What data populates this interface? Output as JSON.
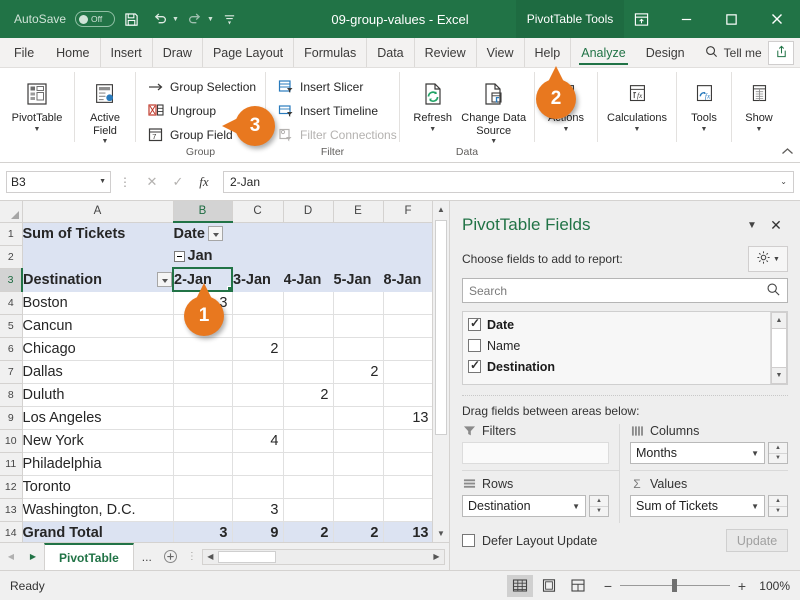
{
  "titlebar": {
    "autosave_label": "AutoSave",
    "autosave_state": "Off",
    "document_title": "09-group-values  -  Excel",
    "contextual_tab": "PivotTable Tools",
    "save_icon": "save-icon",
    "undo_icon": "undo-icon",
    "redo_icon": "redo-icon",
    "customize_icon": "customize-quick-access-icon",
    "ribbon_display_icon": "ribbon-display-options-icon",
    "minimize_icon": "minimize-icon",
    "maximize_icon": "maximize-icon",
    "close_icon": "close-icon"
  },
  "ribbon_tabs": [
    {
      "label": "File",
      "active": false
    },
    {
      "label": "Home",
      "active": false
    },
    {
      "label": "Insert",
      "active": false
    },
    {
      "label": "Draw",
      "active": false
    },
    {
      "label": "Page Layout",
      "active": false
    },
    {
      "label": "Formulas",
      "active": false
    },
    {
      "label": "Data",
      "active": false
    },
    {
      "label": "Review",
      "active": false
    },
    {
      "label": "View",
      "active": false
    },
    {
      "label": "Help",
      "active": false
    },
    {
      "label": "Analyze",
      "active": true
    },
    {
      "label": "Design",
      "active": false
    }
  ],
  "tellme": {
    "label": "Tell me",
    "icon": "search-icon"
  },
  "share": {
    "icon": "share-icon"
  },
  "ribbon": {
    "groups": [
      {
        "label": "",
        "buttons": [
          {
            "label": "PivotTable",
            "icon": "pivottable-icon",
            "caret": true
          }
        ]
      },
      {
        "label": "",
        "buttons": [
          {
            "label": "Active Field",
            "icon": "active-field-icon",
            "caret": true
          }
        ]
      },
      {
        "label": "Group",
        "small": [
          {
            "label": "Group Selection",
            "icon": "group-selection-icon",
            "disabled": false
          },
          {
            "label": "Ungroup",
            "icon": "ungroup-icon",
            "disabled": false
          },
          {
            "label": "Group Field",
            "icon": "group-field-icon",
            "disabled": false
          }
        ]
      },
      {
        "label": "Filter",
        "small": [
          {
            "label": "Insert Slicer",
            "icon": "insert-slicer-icon",
            "disabled": false
          },
          {
            "label": "Insert Timeline",
            "icon": "insert-timeline-icon",
            "disabled": false
          },
          {
            "label": "Filter Connections",
            "icon": "filter-connections-icon",
            "disabled": true
          }
        ]
      },
      {
        "label": "Data",
        "buttons": [
          {
            "label": "Refresh",
            "icon": "refresh-icon",
            "caret": true
          },
          {
            "label": "Change Data Source",
            "icon": "change-data-source-icon",
            "caret": true
          }
        ]
      },
      {
        "label": "",
        "buttons": [
          {
            "label": "Actions",
            "icon": "actions-icon",
            "caret": true
          }
        ]
      },
      {
        "label": "",
        "buttons": [
          {
            "label": "Calculations",
            "icon": "calculations-icon",
            "caret": true
          }
        ]
      },
      {
        "label": "",
        "buttons": [
          {
            "label": "Tools",
            "icon": "tools-icon",
            "caret": true
          }
        ]
      },
      {
        "label": "",
        "buttons": [
          {
            "label": "Show",
            "icon": "show-icon",
            "caret": true
          }
        ]
      }
    ],
    "collapse_icon": "collapse-ribbon-icon"
  },
  "formulabar": {
    "namebox_value": "B3",
    "cancel_icon": "cancel-icon",
    "enter_icon": "enter-icon",
    "function_icon": "insert-function-icon",
    "formula_value": "2-Jan",
    "expand_icon": "expand-formula-bar-icon"
  },
  "grid": {
    "columns": [
      "A",
      "B",
      "C",
      "D",
      "E",
      "F"
    ],
    "selected_column": "B",
    "selected_row": "3",
    "active_cell": "B3",
    "rows": [
      {
        "num": "1",
        "cells": [
          "Sum of Tickets",
          "Date",
          "",
          "",
          "",
          ""
        ]
      },
      {
        "num": "2",
        "cells": [
          "",
          "Jan",
          "",
          "",
          "",
          ""
        ]
      },
      {
        "num": "3",
        "cells": [
          "Destination",
          "2-Jan",
          "3-Jan",
          "4-Jan",
          "5-Jan",
          "8-Jan"
        ]
      },
      {
        "num": "4",
        "cells": [
          "Boston",
          "3",
          "",
          "",
          "",
          ""
        ]
      },
      {
        "num": "5",
        "cells": [
          "Cancun",
          "",
          "",
          "",
          "",
          ""
        ]
      },
      {
        "num": "6",
        "cells": [
          "Chicago",
          "",
          "2",
          "",
          "",
          ""
        ]
      },
      {
        "num": "7",
        "cells": [
          "Dallas",
          "",
          "",
          "",
          "2",
          ""
        ]
      },
      {
        "num": "8",
        "cells": [
          "Duluth",
          "",
          "",
          "2",
          "",
          ""
        ]
      },
      {
        "num": "9",
        "cells": [
          "Los Angeles",
          "",
          "",
          "",
          "",
          "13"
        ]
      },
      {
        "num": "10",
        "cells": [
          "New York",
          "",
          "4",
          "",
          "",
          ""
        ]
      },
      {
        "num": "11",
        "cells": [
          "Philadelphia",
          "",
          "",
          "",
          "",
          ""
        ]
      },
      {
        "num": "12",
        "cells": [
          "Toronto",
          "",
          "",
          "",
          "",
          ""
        ]
      },
      {
        "num": "13",
        "cells": [
          "Washington, D.C.",
          "",
          "3",
          "",
          "",
          ""
        ]
      },
      {
        "num": "14",
        "cells": [
          "Grand Total",
          "3",
          "9",
          "2",
          "2",
          "13"
        ]
      }
    ],
    "group_label": "Jan",
    "collapse_icon": "collapse-group-icon",
    "field_filter_icon": "filter-dropdown-icon"
  },
  "sheet_tabs": {
    "prev_icon": "previous-sheet-icon",
    "next_icon": "next-sheet-icon",
    "tabs": [
      "PivotTable"
    ],
    "more": "...",
    "add_icon": "add-sheet-icon"
  },
  "pivot_pane": {
    "title": "PivotTable Fields",
    "menu_icon": "pane-menu-icon",
    "close_icon": "close-icon",
    "choose_label": "Choose fields to add to report:",
    "gear_icon": "gear-icon",
    "search_placeholder": "Search",
    "search_value": "",
    "search_icon": "search-icon",
    "fields": [
      {
        "label": "Date",
        "checked": true
      },
      {
        "label": "Name",
        "checked": false
      },
      {
        "label": "Destination",
        "checked": true
      }
    ],
    "drag_label": "Drag fields between areas below:",
    "areas": [
      {
        "name": "Filters",
        "icon": "filter-icon",
        "items": []
      },
      {
        "name": "Columns",
        "icon": "columns-icon",
        "items": [
          "Months"
        ]
      },
      {
        "name": "Rows",
        "icon": "rows-icon",
        "items": [
          "Destination"
        ]
      },
      {
        "name": "Values",
        "icon": "sigma-icon",
        "items": [
          "Sum of Tickets"
        ]
      }
    ],
    "defer_label": "Defer Layout Update",
    "update_label": "Update"
  },
  "statusbar": {
    "status": "Ready",
    "view_normal_icon": "normal-view-icon",
    "view_pagelayout_icon": "page-layout-view-icon",
    "view_pagebreak_icon": "page-break-view-icon",
    "zoom_out": "−",
    "zoom_in": "+",
    "zoom_level": "100%"
  },
  "callouts": [
    {
      "number": "1"
    },
    {
      "number": "2"
    },
    {
      "number": "3"
    }
  ],
  "colors": {
    "excel_green": "#217346",
    "callout_orange": "#e8781f",
    "header_fill": "#dce3f2"
  }
}
